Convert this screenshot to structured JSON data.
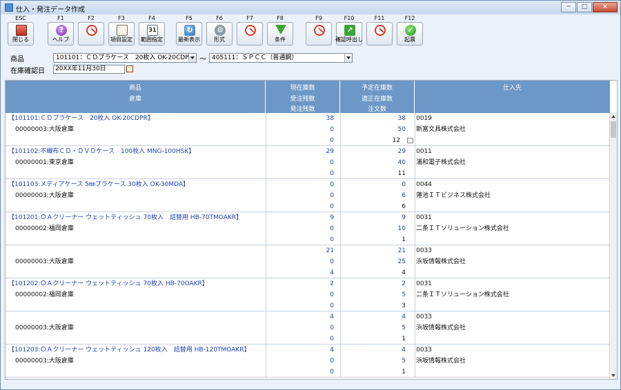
{
  "window": {
    "title": "仕入・発注データ作成"
  },
  "toolbar": {
    "keys": [
      {
        "key": "ESC",
        "label": "閉じる",
        "icon": "close-window-icon"
      },
      {
        "key": "F1",
        "label": "ヘルプ",
        "icon": "help-icon"
      },
      {
        "key": "F2",
        "label": "",
        "icon": "disabled-icon"
      },
      {
        "key": "F3",
        "label": "項目設定",
        "icon": "table-settings-icon"
      },
      {
        "key": "F4",
        "label": "範囲指定",
        "icon": "calendar-icon"
      },
      {
        "key": "F5",
        "label": "最新表示",
        "icon": "refresh-icon"
      },
      {
        "key": "F6",
        "label": "形式",
        "icon": "gear-icon"
      },
      {
        "key": "F7",
        "label": "",
        "icon": "disabled-icon"
      },
      {
        "key": "F8",
        "label": "条件",
        "icon": "filter-icon"
      },
      {
        "key": "F9",
        "label": "",
        "icon": "disabled-icon"
      },
      {
        "key": "F10",
        "label": "確認呼出し",
        "icon": "arrow-icon"
      },
      {
        "key": "F11",
        "label": "",
        "icon": "disabled-icon"
      },
      {
        "key": "F12",
        "label": "起票",
        "icon": "check-icon"
      }
    ]
  },
  "filters": {
    "product_label": "商品",
    "product_from": "101101：ＣＤプラケース　20枚入 OK-20CDPR",
    "tilde": "～",
    "product_to": "405111：ＳＰＣＣ（普通鋼）",
    "date_label": "在庫確認日",
    "date_value": "20XX年11月30日"
  },
  "grid": {
    "headers": {
      "product": "商品",
      "warehouse": "倉庫",
      "stock": "現在庫数",
      "order_received": "受注残数",
      "order_placed": "発注残数",
      "planned_stock": "予定在庫数",
      "proper_stock": "適正在庫数",
      "order_qty": "注文数",
      "supplier": "仕入先"
    },
    "records": [
      {
        "product": "【101101:ＣＤプラケース　20枚入 OK-20CDPR】",
        "warehouse": "00000003:大阪倉庫",
        "stock": "38",
        "received": "0",
        "placed": "0",
        "planned": "38",
        "proper": "50",
        "order": "12",
        "sup_code": "0019",
        "sup_name": "新富文具株式会社"
      },
      {
        "product": "【101102:不織布ＣＤ・ＤＶＤケース　100枚入 MNG-100HSK】",
        "warehouse": "00000001:東京倉庫",
        "stock": "29",
        "received": "0",
        "placed": "0",
        "planned": "29",
        "proper": "40",
        "order": "11",
        "sup_code": "0011",
        "sup_name": "浦和電子株式会社"
      },
      {
        "product": "【101103:メディアケース 5㎜プラケース 30枚入 OK-30MDA】",
        "warehouse": "00000003:大阪倉庫",
        "stock": "0",
        "received": "0",
        "placed": "0",
        "planned": "0",
        "proper": "6",
        "order": "6",
        "sup_code": "0044",
        "sup_name": "蓮池ＩＴビジネス株式会社"
      },
      {
        "product": "【101201:ＯＡクリーナー ウェットティッシュ 70枚入　詰替用 HB-70TMOAKR】",
        "warehouse": "00000002:福岡倉庫",
        "stock": "9",
        "received": "0",
        "placed": "0",
        "planned": "9",
        "proper": "10",
        "order": "1",
        "sup_code": "0031",
        "sup_name": "二条ＩＴソリューション株式会社"
      },
      {
        "product": "",
        "warehouse": "00000003:大阪倉庫",
        "stock": "21",
        "received": "0",
        "placed": "4",
        "planned": "21",
        "proper": "25",
        "order": "4",
        "sup_code": "0033",
        "sup_name": "浜坂情報株式会社"
      },
      {
        "product": "【101202:ＯＡクリーナー ウェットティッシュ 70枚入 HB-70OAKR】",
        "warehouse": "00000002:福岡倉庫",
        "stock": "2",
        "received": "0",
        "placed": "0",
        "planned": "2",
        "proper": "5",
        "order": "3",
        "sup_code": "0031",
        "sup_name": "二条ＩＴソリューション株式会社"
      },
      {
        "product": "",
        "warehouse": "00000003:大阪倉庫",
        "stock": "4",
        "received": "0",
        "placed": "0",
        "planned": "4",
        "proper": "5",
        "order": "1",
        "sup_code": "0033",
        "sup_name": "浜坂情報株式会社"
      },
      {
        "product": "【101203:ＯＡクリーナー ウェットティッシュ 120枚入　詰替用 HB-120TMOAKR】",
        "warehouse": "00000003:大阪倉庫",
        "stock": "4",
        "received": "0",
        "placed": "0",
        "planned": "4",
        "proper": "5",
        "order": "1",
        "sup_code": "0033",
        "sup_name": "浜坂情報株式会社"
      }
    ]
  },
  "colors": {
    "header_bg": "#6d97c7",
    "link_blue": "#1f3fb0",
    "window_bg": "#eaf1f8"
  }
}
